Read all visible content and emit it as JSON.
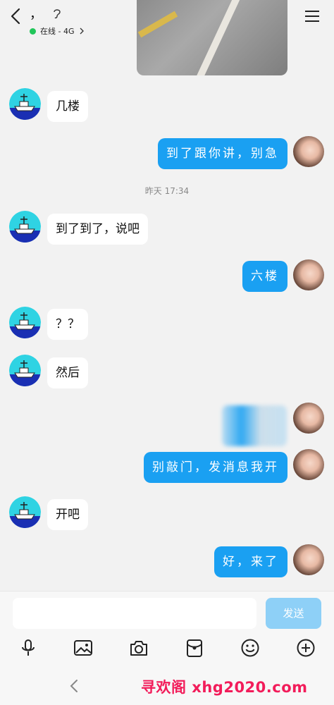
{
  "header": {
    "title": "，",
    "status_text": "在线 - 4G"
  },
  "messages": [
    {
      "side": "left",
      "text": "几楼"
    },
    {
      "side": "right",
      "text": "到了跟你讲，别急"
    },
    {
      "side": "left",
      "text": "到了到了，说吧"
    },
    {
      "side": "right",
      "text": "六楼"
    },
    {
      "side": "left",
      "text": "？？"
    },
    {
      "side": "left",
      "text": "然后"
    },
    {
      "side": "right",
      "text": "别敲门，发消息我开"
    },
    {
      "side": "left",
      "text": "开吧"
    },
    {
      "side": "right",
      "text": "好，来了"
    }
  ],
  "timestamp": "昨天 17:34",
  "input": {
    "value": "",
    "send_label": "发送"
  },
  "toolbar": {
    "icons": [
      "microphone-icon",
      "image-icon",
      "camera-icon",
      "red-packet-icon",
      "emoji-icon",
      "plus-icon"
    ]
  },
  "watermark": "寻欢阁 xhg2020.com",
  "colors": {
    "outgoing_bubble": "#1aa0f2",
    "send_button": "#8ed0f7",
    "online_dot": "#21c65a",
    "watermark": "#f21c5a"
  }
}
